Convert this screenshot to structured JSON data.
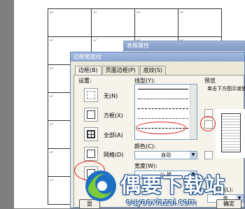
{
  "document": {
    "cell_mark": "↵"
  },
  "back_dialog": {
    "title": "表格属性"
  },
  "dialog": {
    "title": "边框和底纹",
    "tabs": [
      "边框(B)",
      "页面边框(P)",
      "底纹(S)"
    ],
    "settings_label": "设置:",
    "settings": [
      "无(N)",
      "方框(X)",
      "全部(A)",
      "网格(D)",
      "自"
    ],
    "style_label": "线型(Y):",
    "color_label": "颜色(C):",
    "color_value": "自动",
    "width_label": "宽度(W):",
    "width_value": "½ 磅",
    "preview_label": "预览",
    "preview_hint": "单击下方图示或使",
    "apply_label": "应用于(L):",
    "apply_value": "单",
    "ok_button": "确定",
    "left_button": "显"
  },
  "colors": {
    "accent_red": "#d22222",
    "dialog_bg": "#ece9d8",
    "title_blue": "#8aa4cf"
  },
  "watermark": {
    "text": "偶要下载站",
    "url": "ouyaoxiazai.com",
    "logo": "ouyao-logo"
  }
}
